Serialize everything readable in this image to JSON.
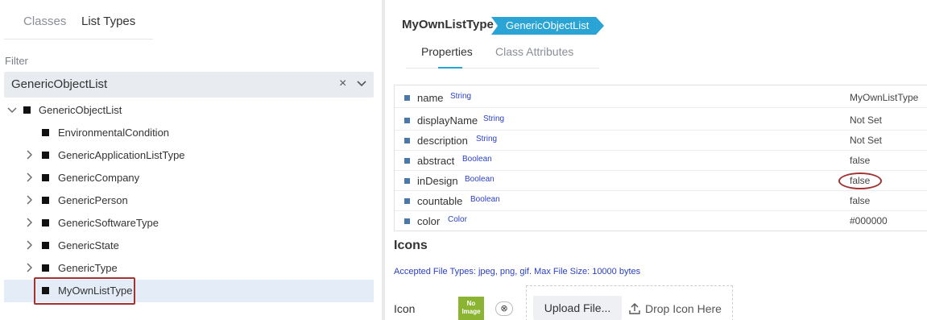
{
  "left": {
    "tabs": [
      {
        "label": "Classes"
      },
      {
        "label": "List Types"
      }
    ],
    "filter": {
      "label": "Filter",
      "value": "GenericObjectList",
      "clear_glyph": "×"
    },
    "tree": [
      {
        "label": "GenericObjectList",
        "expanded": true
      },
      {
        "label": "EnvironmentalCondition"
      },
      {
        "label": "GenericApplicationListType"
      },
      {
        "label": "GenericCompany"
      },
      {
        "label": "GenericPerson"
      },
      {
        "label": "GenericSoftwareType"
      },
      {
        "label": "GenericState"
      },
      {
        "label": "GenericType"
      },
      {
        "label": "MyOwnListType",
        "selected": true
      }
    ]
  },
  "right": {
    "title": "MyOwnListType",
    "badge": "GenericObjectList",
    "tabs": [
      {
        "label": "Properties"
      },
      {
        "label": "Class Attributes"
      }
    ],
    "properties": [
      {
        "name": "name",
        "type": "String",
        "value": "MyOwnListType"
      },
      {
        "name": "displayName",
        "type": "String",
        "value": "Not Set"
      },
      {
        "name": "description",
        "type": "String",
        "value": "Not Set"
      },
      {
        "name": "abstract",
        "type": "Boolean",
        "value": "false"
      },
      {
        "name": "inDesign",
        "type": "Boolean",
        "value": "false"
      },
      {
        "name": "countable",
        "type": "Boolean",
        "value": "false"
      },
      {
        "name": "color",
        "type": "Color",
        "value": "#000000"
      }
    ],
    "icons": {
      "heading": "Icons",
      "accepted": "Accepted File Types: jpeg, png, gif. Max File Size: 10000 bytes",
      "icon_label": "Icon",
      "no_image_1": "No",
      "no_image_2": "Image",
      "remove_glyph": "⊗",
      "upload_label": "Upload File...",
      "drop_label": "Drop Icon Here"
    }
  },
  "colors": {
    "accent": "#2aa4d5",
    "highlight": "#a33232",
    "type_text": "#2b3fc4",
    "no_image": "#8ab432"
  }
}
